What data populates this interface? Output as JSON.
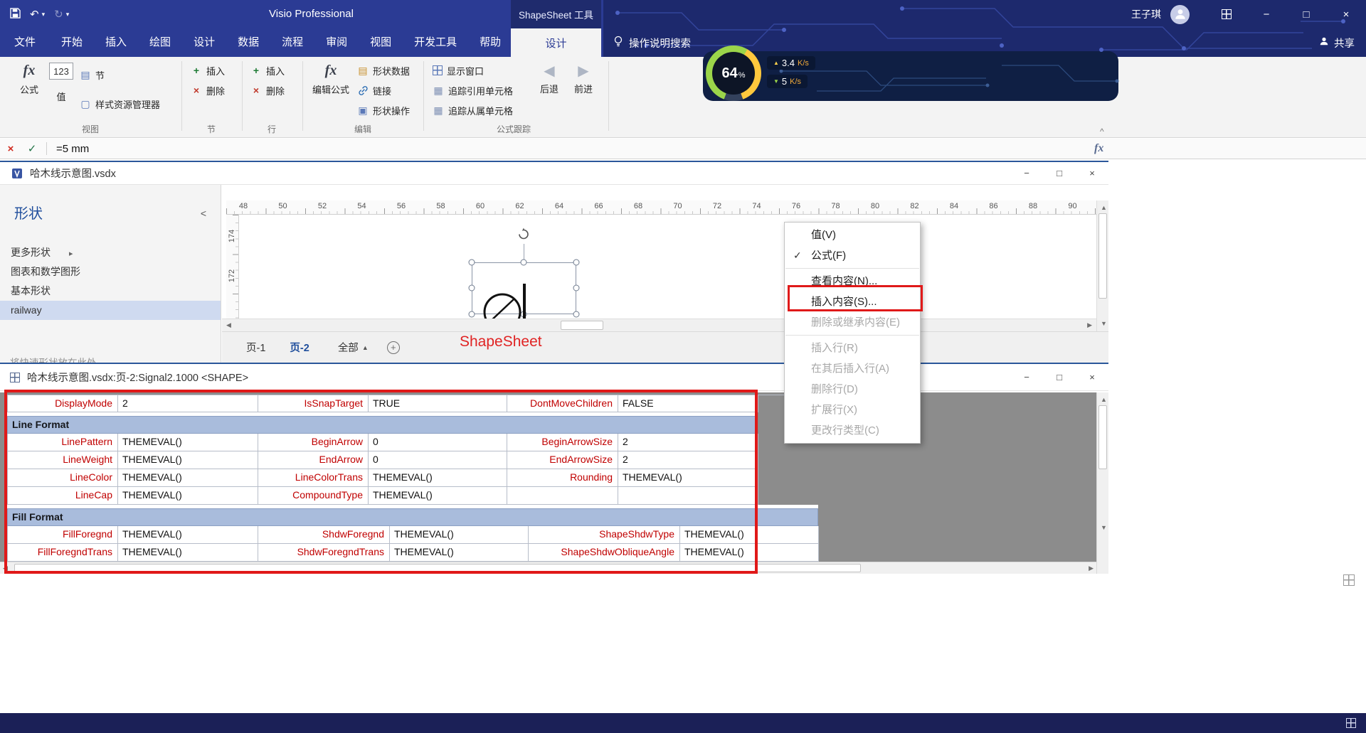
{
  "icons": {
    "fx": "fx",
    "undo": "↶",
    "redo": "↻",
    "caret": "▾",
    "minimize": "−",
    "maximize": "□",
    "close": "×",
    "check": "✓",
    "cancel": "×",
    "up": "▲",
    "down": "▼",
    "left": "◀",
    "right": "▶",
    "flyout": "▸",
    "collapse_panel": "<",
    "collapse_ribbon": "^",
    "plus": "+",
    "cross": "×",
    "grid3": "▤",
    "grid2": "▦",
    "box": "▢",
    "boxdot": "▣"
  },
  "titlebar": {
    "app_title": "Visio Professional",
    "contextual_group": "ShapeSheet 工具",
    "user_name": "王子琪"
  },
  "ribbon_tabs": {
    "file": "文件",
    "tabs": [
      "开始",
      "插入",
      "绘图",
      "设计",
      "数据",
      "流程",
      "审阅",
      "视图",
      "开发工具",
      "帮助"
    ],
    "contextual_tab": "设计",
    "search_label": "操作说明搜索",
    "share_label": "共享"
  },
  "ribbon": {
    "groups": [
      {
        "label": "视图"
      },
      {
        "label": "节"
      },
      {
        "label": "行"
      },
      {
        "label": "编辑"
      },
      {
        "label": "公式跟踪"
      }
    ],
    "buttons": {
      "formula": "公式",
      "value_123": "123",
      "value": "值",
      "section_btn": "节",
      "style_explorer": "样式资源管理器",
      "sec_insert": "插入",
      "sec_delete": "删除",
      "row_insert": "插入",
      "row_delete": "删除",
      "edit_formula": "编辑公式",
      "shape_data": "形状数据",
      "link": "链接",
      "shape_ops": "形状操作",
      "show_window": "显示窗口",
      "trace_precedents": "追踪引用单元格",
      "trace_dependents": "追踪从属单元格",
      "back": "后退",
      "forward": "前进"
    }
  },
  "formula_bar": {
    "value": "=5 mm"
  },
  "drawing_window": {
    "title": "哈木线示意图.vsdx",
    "shapes_panel": {
      "header": "形状",
      "items": [
        {
          "label": "更多形状",
          "flyout": true
        },
        {
          "label": "图表和数学图形"
        },
        {
          "label": "基本形状"
        },
        {
          "label": "railway",
          "selected": true
        }
      ],
      "drop_hint": "将快速形状放在此处"
    },
    "ruler_h": [
      48,
      50,
      52,
      54,
      56,
      58,
      60,
      62,
      64,
      66,
      68,
      70,
      72,
      74,
      76,
      78,
      80,
      82,
      84,
      86,
      88,
      90
    ],
    "ruler_v": [
      174,
      172
    ],
    "page_tabs": {
      "pages": [
        "页-1",
        "页-2"
      ],
      "active": "页-2",
      "all_label": "全部"
    }
  },
  "annotations": {
    "shapesheet_label": "ShapeSheet"
  },
  "context_menu": {
    "items": [
      {
        "type": "item",
        "label": "值(V)",
        "enabled": true
      },
      {
        "type": "item",
        "label": "公式(F)",
        "enabled": true,
        "checked": true
      },
      {
        "type": "sep"
      },
      {
        "type": "item",
        "label": "查看内容(N)...",
        "enabled": true
      },
      {
        "type": "item",
        "label": "插入内容(S)...",
        "enabled": true
      },
      {
        "type": "item",
        "label": "删除或继承内容(E)",
        "enabled": false
      },
      {
        "type": "sep"
      },
      {
        "type": "item",
        "label": "插入行(R)",
        "enabled": false
      },
      {
        "type": "item",
        "label": "在其后插入行(A)",
        "enabled": false
      },
      {
        "type": "item",
        "label": "删除行(D)",
        "enabled": false
      },
      {
        "type": "item",
        "label": "扩展行(X)",
        "enabled": false
      },
      {
        "type": "item",
        "label": "更改行类型(C)",
        "enabled": false
      }
    ]
  },
  "shapesheet": {
    "title": "哈木线示意图.vsdx:页-2:Signal2.1000 <SHAPE>",
    "rows": [
      {
        "t": "row",
        "layout": "A",
        "first": true,
        "cells": [
          [
            "DisplayMode",
            "2"
          ],
          [
            "IsSnapTarget",
            "TRUE"
          ],
          [
            "DontMoveChildren",
            "FALSE"
          ]
        ]
      },
      {
        "t": "sec",
        "layout": "A",
        "label": "Line Format"
      },
      {
        "t": "row",
        "layout": "A",
        "cells": [
          [
            "LinePattern",
            "THEMEVAL()"
          ],
          [
            "BeginArrow",
            "0"
          ],
          [
            "BeginArrowSize",
            "2"
          ]
        ]
      },
      {
        "t": "row",
        "layout": "A",
        "cells": [
          [
            "LineWeight",
            "THEMEVAL()"
          ],
          [
            "EndArrow",
            "0"
          ],
          [
            "EndArrowSize",
            "2"
          ]
        ]
      },
      {
        "t": "row",
        "layout": "A",
        "cells": [
          [
            "LineColor",
            "THEMEVAL()"
          ],
          [
            "LineColorTrans",
            "THEMEVAL()"
          ],
          [
            "Rounding",
            "THEMEVAL()"
          ]
        ]
      },
      {
        "t": "row",
        "layout": "A",
        "cells": [
          [
            "LineCap",
            "THEMEVAL()"
          ],
          [
            "CompoundType",
            "THEMEVAL()"
          ],
          [
            "",
            ""
          ]
        ]
      },
      {
        "t": "sec",
        "layout": "B",
        "label": "Fill Format"
      },
      {
        "t": "row",
        "layout": "B",
        "cells": [
          [
            "FillForegnd",
            "THEMEVAL()"
          ],
          [
            "ShdwForegnd",
            "THEMEVAL()"
          ],
          [
            "ShapeShdwType",
            "THEMEVAL()"
          ]
        ]
      },
      {
        "t": "row",
        "layout": "B",
        "cells": [
          [
            "FillForegndTrans",
            "THEMEVAL()"
          ],
          [
            "ShdwForegndTrans",
            "THEMEVAL()"
          ],
          [
            "ShapeShdwObliqueAngle",
            "THEMEVAL()"
          ]
        ]
      }
    ]
  },
  "network_widget": {
    "percent": "64",
    "percent_sign": "%",
    "up_value": "3.4",
    "up_unit": "K/s",
    "down_value": "5",
    "down_unit": "K/s"
  },
  "colors": {
    "accent_blue": "#2b3b94",
    "window_border_blue": "#2b579a",
    "cell_label_red": "#c00000",
    "section_bar": "#a9bcdc",
    "annotation_red": "#e01919",
    "active_page_blue": "#1f4e9c",
    "content_gray": "#8c8c8c"
  }
}
